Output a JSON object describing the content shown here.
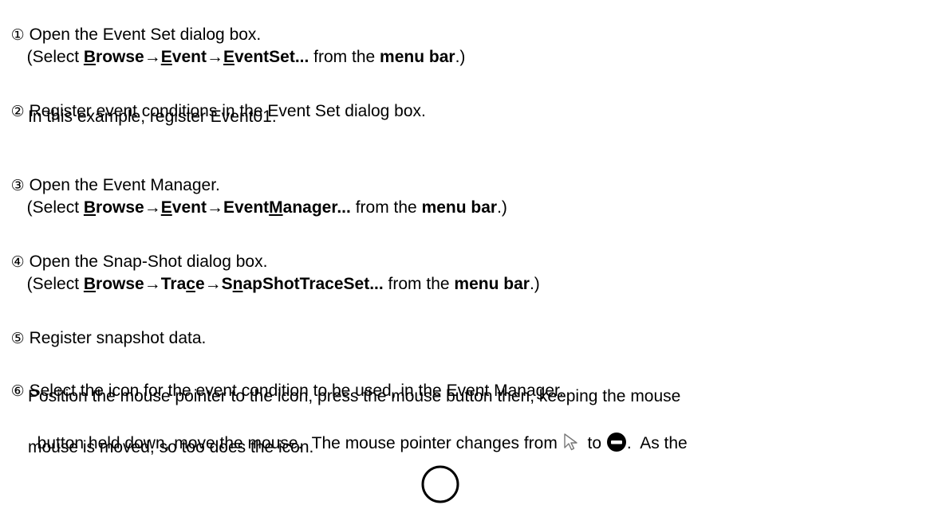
{
  "steps": [
    {
      "num": "①",
      "title": "Open the Event Set dialog box.",
      "sel_open": "(Select ",
      "menu": [
        {
          "u": "B",
          "rest": "rowse"
        },
        {
          "sep": "→"
        },
        {
          "u": "E",
          "rest": "vent"
        },
        {
          "sep": "→"
        },
        {
          "u": "E",
          "rest": "ventSet..."
        }
      ],
      "from": " from the ",
      "menu_bar": "menu bar",
      "close": ".)"
    },
    {
      "num": "②",
      "title": "Register event conditions in the Event Set dialog box.",
      "detail": "In this example, register Event01."
    },
    {
      "num": "③",
      "title": "Open the Event Manager.",
      "sel_open": "(Select ",
      "menu_parts": [
        "rowse",
        "→",
        "vent",
        "→Event",
        "anager..."
      ],
      "menu_u": [
        "B",
        "E",
        "M"
      ],
      "from": " from the ",
      "menu_bar": "menu bar",
      "close": ".)"
    },
    {
      "num": "④",
      "title": "Open the Snap-Shot dialog box.",
      "sel_open": "(Select ",
      "menu_parts": [
        "rowse",
        "→Tra",
        "e→S",
        "apShotTraceSet..."
      ],
      "menu_u": [
        "B",
        "c",
        "n"
      ],
      "from": " from the ",
      "menu_bar": "menu bar",
      "close": ".)"
    },
    {
      "num": "⑤",
      "title": "Register snapshot data."
    },
    {
      "num": "⑥",
      "title": "Select the icon for the event condition to be used, in the Event Manager.",
      "detail1": "Position the mouse pointer to the icon, press the mouse button then, keeping the mouse",
      "detail2a": "button held down, move the mouse.  The mouse pointer changes from ",
      "detail2b": " to ",
      "detail2c": ".  As the",
      "detail3": "mouse is moved, so too does the icon."
    }
  ],
  "icons": [
    "arrow-pointer-icon",
    "no-drop-icon"
  ]
}
